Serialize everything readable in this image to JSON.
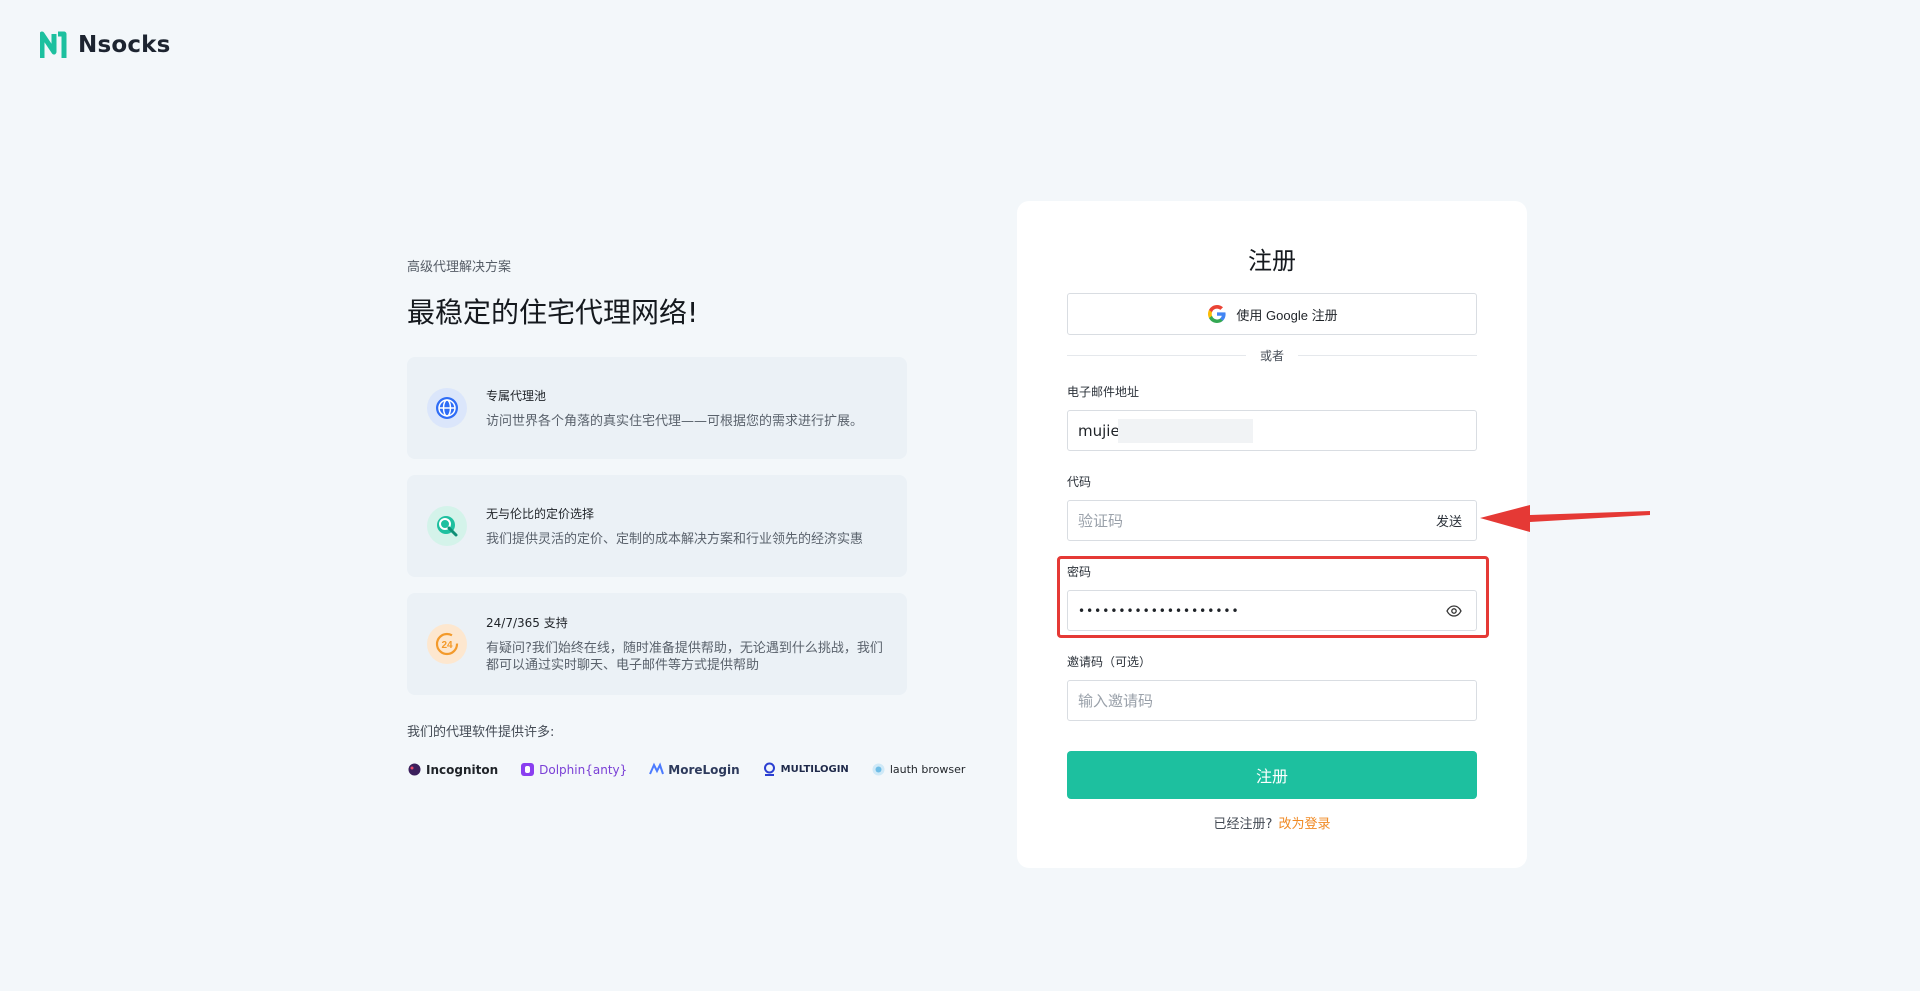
{
  "brand": {
    "name": "Nsocks",
    "color": "#1dc09f"
  },
  "hero": {
    "subtitle": "高级代理解决方案",
    "headline": "最稳定的住宅代理网络!"
  },
  "features": [
    {
      "icon": "globe-icon",
      "title": "专属代理池",
      "desc": "访问世界各个角落的真实住宅代理——可根据您的需求进行扩展。"
    },
    {
      "icon": "price-search-icon",
      "title": "无与伦比的定价选择",
      "desc": "我们提供灵活的定价、定制的成本解决方案和行业领先的经济实惠"
    },
    {
      "icon": "support-24-icon",
      "title": "24/7/365 支持",
      "desc": "有疑问?我们始终在线，随时准备提供帮助，无论遇到什么挑战，我们都可以通过实时聊天、电子邮件等方式提供帮助"
    }
  ],
  "partners_label": "我们的代理软件提供许多:",
  "partners": [
    "Incogniton",
    "Dolphin{anty}",
    "MoreLogin",
    "MULTILOGIN",
    "lauth browser"
  ],
  "form": {
    "title": "注册",
    "google_label": "使用 Google 注册",
    "or_label": "或者",
    "email_label": "电子邮件地址",
    "email_value": "mujie",
    "code_label": "代码",
    "code_placeholder": "验证码",
    "send_label": "发送",
    "password_label": "密码",
    "password_value": "••••••••••••••••••••",
    "invite_label": "邀请码（可选）",
    "invite_placeholder": "输入邀请码",
    "submit_label": "注册",
    "login_prompt": "已经注册?",
    "login_link": "改为登录"
  },
  "annotation": {
    "highlight_color": "#e53935"
  }
}
